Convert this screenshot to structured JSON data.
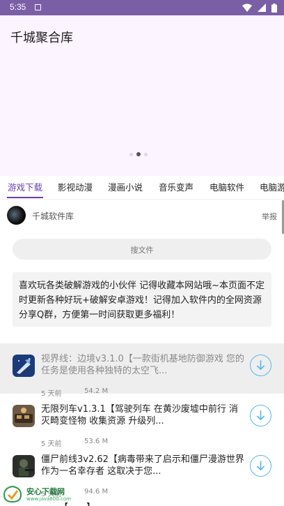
{
  "status": {
    "time": "5:35",
    "app_icon": "notification-app-icon",
    "icons": [
      "wifi-icon",
      "signal-icon",
      "battery-icon"
    ]
  },
  "header": {
    "title": "千城聚合库",
    "pager": {
      "count": 3,
      "active": 2
    }
  },
  "tabs": [
    {
      "label": "游戏下载",
      "active": true
    },
    {
      "label": "影视动漫",
      "active": false
    },
    {
      "label": "漫画小说",
      "active": false
    },
    {
      "label": "音乐变声",
      "active": false
    },
    {
      "label": "电脑软件",
      "active": false
    },
    {
      "label": "电脑游",
      "active": false
    }
  ],
  "channel": {
    "name": "千城软件库",
    "report_label": "举报"
  },
  "search": {
    "placeholder": "搜文件"
  },
  "notice": {
    "text": "喜欢玩各类破解游戏的小伙伴 记得收藏本网站哦~本页面不定时更新各种好玩+破解安卓游戏！记得加入软件内的全网资源分享Q群，方便第一时间获取更多福利！"
  },
  "files": [
    {
      "title": "视界线：边境v3.1.0【一款街机基地防御游戏 您的任务是使用各种独特的太空飞...",
      "time": "5 天前",
      "size": "54.2 M",
      "icon": "space-game-icon",
      "highlighted": true
    },
    {
      "title": "无限列车v1.3.1【驾驶列车 在黄沙废墟中前行 消灭畸变怪物 收集资源 升级列...",
      "time": "5 天前",
      "size": "53.6 M",
      "icon": "train-game-icon",
      "highlighted": false
    },
    {
      "title": "僵尸前线3v2.62【病毒带来了启示和僵尸漫游世界 作为一名幸存者 这取决于您...",
      "time": "5 天前",
      "size": "94.6 M",
      "icon": "zombie-game-icon",
      "highlighted": false
    }
  ],
  "partial_next_title": "……【……】",
  "watermark": {
    "name": "安心下载网",
    "url": "www.java800.com"
  },
  "colors": {
    "accent": "#6a3fb0",
    "status_bar": "#7b5fa6",
    "download": "#58b7e8"
  }
}
